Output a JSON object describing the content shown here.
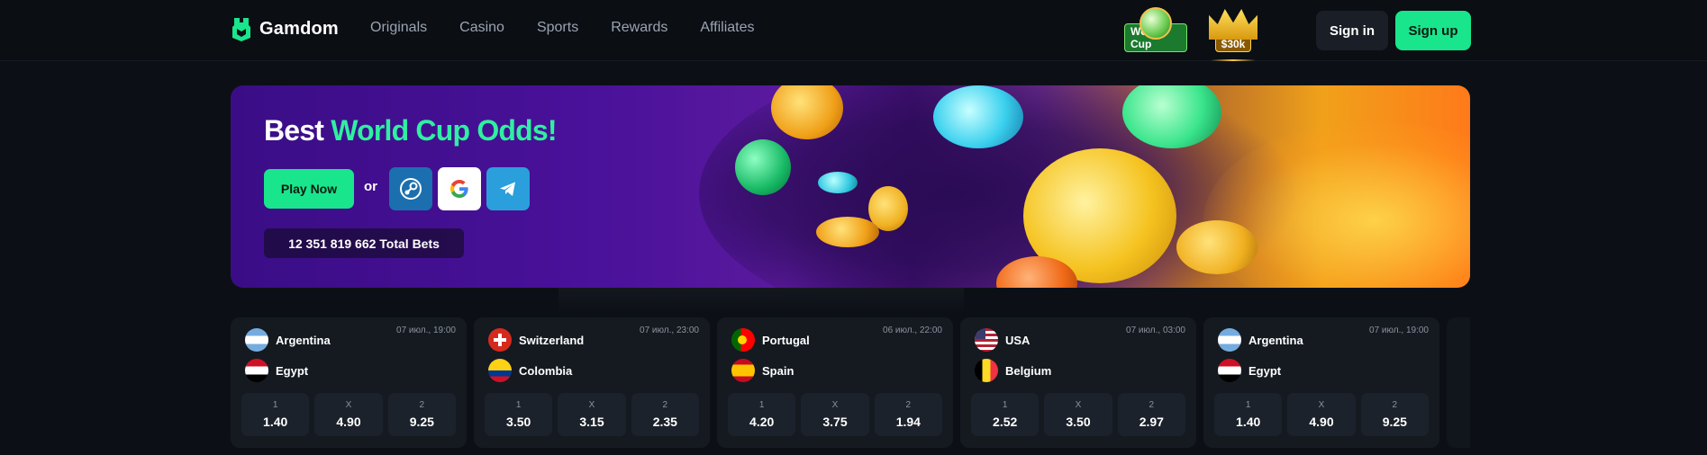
{
  "header": {
    "logo_text": "Gamdom",
    "nav": [
      "Originals",
      "Casino",
      "Sports",
      "Rewards",
      "Affiliates"
    ],
    "promo_world_cup": "World Cup",
    "promo_prize": "$30k",
    "sign_in": "Sign in",
    "sign_up": "Sign up"
  },
  "hero": {
    "title_plain": "Best",
    "title_accent": "World Cup Odds!",
    "play_now": "Play Now",
    "or": "or",
    "social_icons": [
      "steam-icon",
      "google-icon",
      "telegram-icon"
    ],
    "total_bets": "12 351 819 662 Total Bets"
  },
  "matches": [
    {
      "team1": "Argentina",
      "team2": "Egypt",
      "date": "07 июл., 19:00",
      "odds": [
        {
          "label": "1",
          "value": "1.40"
        },
        {
          "label": "X",
          "value": "4.90"
        },
        {
          "label": "2",
          "value": "9.25"
        }
      ]
    },
    {
      "team1": "Switzerland",
      "team2": "Colombia",
      "date": "07 июл., 23:00",
      "odds": [
        {
          "label": "1",
          "value": "3.50"
        },
        {
          "label": "X",
          "value": "3.15"
        },
        {
          "label": "2",
          "value": "2.35"
        }
      ]
    },
    {
      "team1": "Portugal",
      "team2": "Spain",
      "date": "06 июл., 22:00",
      "odds": [
        {
          "label": "1",
          "value": "4.20"
        },
        {
          "label": "X",
          "value": "3.75"
        },
        {
          "label": "2",
          "value": "1.94"
        }
      ]
    },
    {
      "team1": "USA",
      "team2": "Belgium",
      "date": "07 июл., 03:00",
      "odds": [
        {
          "label": "1",
          "value": "2.52"
        },
        {
          "label": "X",
          "value": "3.50"
        },
        {
          "label": "2",
          "value": "2.97"
        }
      ]
    },
    {
      "team1": "Argentina",
      "team2": "Egypt",
      "date": "07 июл., 19:00",
      "odds": [
        {
          "label": "1",
          "value": "1.40"
        },
        {
          "label": "X",
          "value": "4.90"
        },
        {
          "label": "2",
          "value": "9.25"
        }
      ]
    }
  ],
  "colors": {
    "accent": "#19e58c",
    "background": "#0c1016",
    "card": "#151a21"
  }
}
